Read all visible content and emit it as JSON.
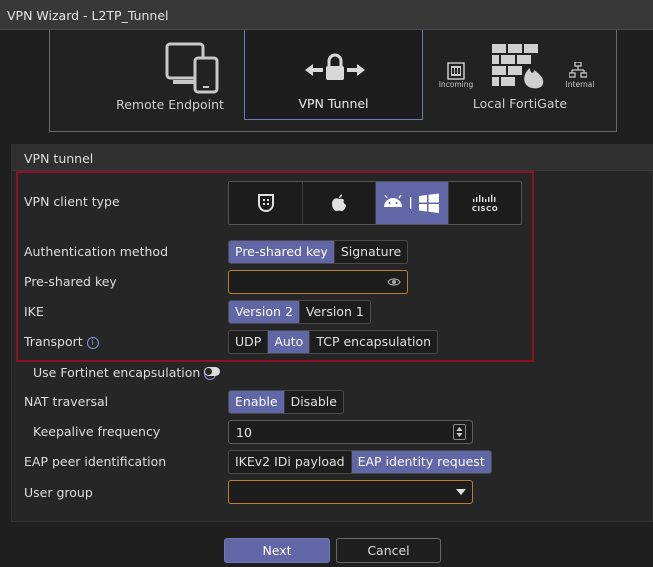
{
  "window": {
    "title": "VPN Wizard - L2TP_Tunnel"
  },
  "topology": {
    "remote_endpoint": "Remote Endpoint",
    "vpn_tunnel": "VPN Tunnel",
    "incoming": "Incoming",
    "local_fortigate": "Local FortiGate",
    "internal": "Internal"
  },
  "section": {
    "title": "VPN tunnel"
  },
  "client_type": {
    "label": "VPN client type",
    "options": [
      "fortinet-icon",
      "apple-icon",
      "android-windows-icon",
      "cisco-icon"
    ],
    "selected": "android-windows-icon",
    "cisco_text": "CISCO"
  },
  "auth": {
    "label": "Authentication method",
    "options": [
      "Pre-shared key",
      "Signature"
    ],
    "selected": "Pre-shared key"
  },
  "psk": {
    "label": "Pre-shared key",
    "value": ""
  },
  "ike": {
    "label": "IKE",
    "options": [
      "Version 2",
      "Version 1"
    ],
    "selected": "Version 2"
  },
  "transport": {
    "label": "Transport",
    "options": [
      "UDP",
      "Auto",
      "TCP encapsulation"
    ],
    "selected": "Auto"
  },
  "fortinet_encap": {
    "label": "Use Fortinet encapsulation",
    "enabled": false
  },
  "nat": {
    "label": "NAT traversal",
    "options": [
      "Enable",
      "Disable"
    ],
    "selected": "Enable"
  },
  "keepalive": {
    "label": "Keepalive frequency",
    "value": "10"
  },
  "eap": {
    "label": "EAP peer identification",
    "options": [
      "IKEv2 IDi payload",
      "EAP identity request"
    ],
    "selected": "EAP identity request"
  },
  "user_group": {
    "label": "User group",
    "value": ""
  },
  "footer": {
    "next": "Next",
    "cancel": "Cancel"
  },
  "colors": {
    "accent": "#6167a6",
    "highlight": "#8e1126",
    "input_border": "#b5813a"
  }
}
